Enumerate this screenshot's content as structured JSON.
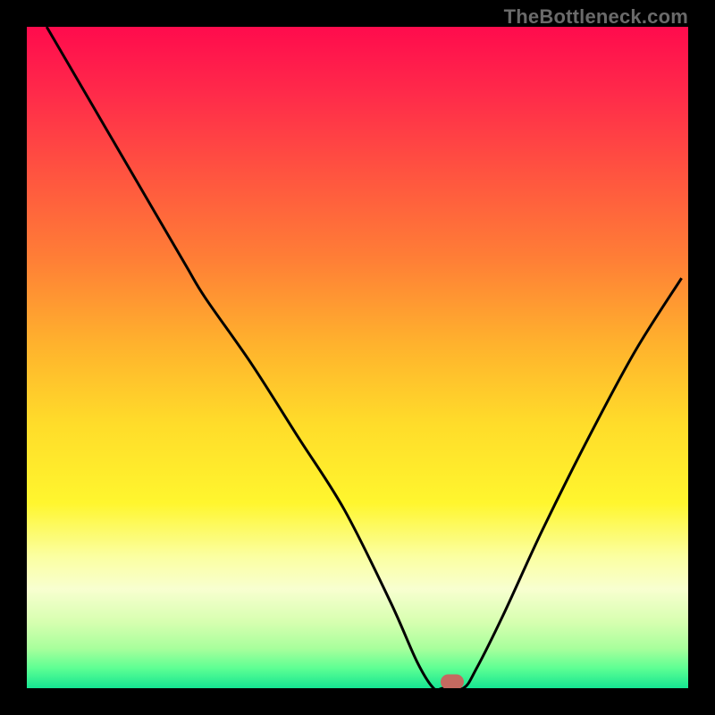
{
  "watermark": "TheBottleneck.com",
  "marker": {
    "x_pct": 64.3,
    "y_pct": 99.0,
    "w": 26,
    "h": 17
  },
  "chart_data": {
    "type": "line",
    "title": "",
    "xlabel": "",
    "ylabel": "",
    "xlim": [
      0,
      100
    ],
    "ylim": [
      0,
      100
    ],
    "background_gradient": {
      "stops": [
        {
          "pct": 0,
          "color": "#ff0b4d"
        },
        {
          "pct": 10,
          "color": "#ff2a4a"
        },
        {
          "pct": 22,
          "color": "#ff5340"
        },
        {
          "pct": 35,
          "color": "#ff7e36"
        },
        {
          "pct": 48,
          "color": "#ffb22d"
        },
        {
          "pct": 60,
          "color": "#ffdc2a"
        },
        {
          "pct": 72,
          "color": "#fff62e"
        },
        {
          "pct": 80,
          "color": "#fbffa0"
        },
        {
          "pct": 85,
          "color": "#f8ffd0"
        },
        {
          "pct": 90,
          "color": "#d7ffb0"
        },
        {
          "pct": 94,
          "color": "#a8ff9c"
        },
        {
          "pct": 97,
          "color": "#5dff93"
        },
        {
          "pct": 100,
          "color": "#15e592"
        }
      ]
    },
    "series": [
      {
        "name": "bottleneck-curve",
        "color": "#000000",
        "width": 3,
        "x": [
          3,
          10,
          17,
          24,
          27,
          34,
          41,
          48,
          55,
          59,
          61.5,
          63,
          66,
          68,
          72,
          78,
          85,
          92,
          99
        ],
        "y": [
          100,
          88,
          76,
          64,
          59,
          49,
          38,
          27,
          13,
          4,
          0,
          0,
          0,
          3,
          11,
          24,
          38,
          51,
          62
        ]
      }
    ],
    "annotations": [
      {
        "type": "marker",
        "name": "optimal-point",
        "x": 64.3,
        "y": 0.8
      }
    ]
  }
}
